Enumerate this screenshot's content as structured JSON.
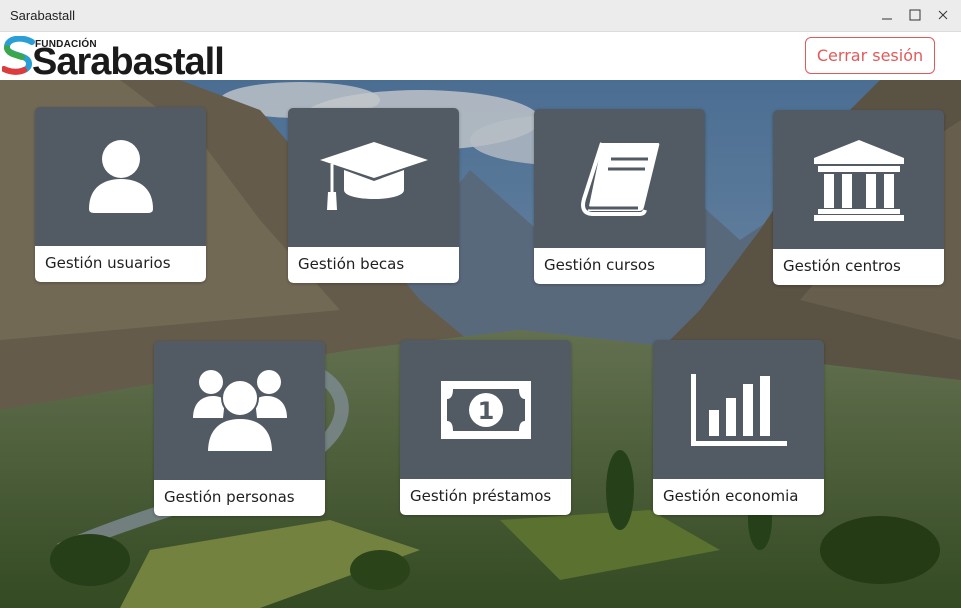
{
  "window": {
    "title": "Sarabastall"
  },
  "header": {
    "logo_small": "FUNDACIÓN",
    "logo_big": "Sarabastall",
    "logout_label": "Cerrar sesión"
  },
  "colors": {
    "tile_bg": "#525a63",
    "label_bg": "#ffffff",
    "logout_accent": "#e05a5a"
  },
  "tiles": [
    {
      "label": "Gestión usuarios",
      "icon": "user-icon"
    },
    {
      "label": "Gestión becas",
      "icon": "graduation-cap-icon"
    },
    {
      "label": "Gestión cursos",
      "icon": "book-icon"
    },
    {
      "label": "Gestión centros",
      "icon": "building-icon"
    },
    {
      "label": "Gestión personas",
      "icon": "users-group-icon"
    },
    {
      "label": "Gestión préstamos",
      "icon": "money-icon"
    },
    {
      "label": "Gestión economia",
      "icon": "bar-chart-icon"
    }
  ]
}
